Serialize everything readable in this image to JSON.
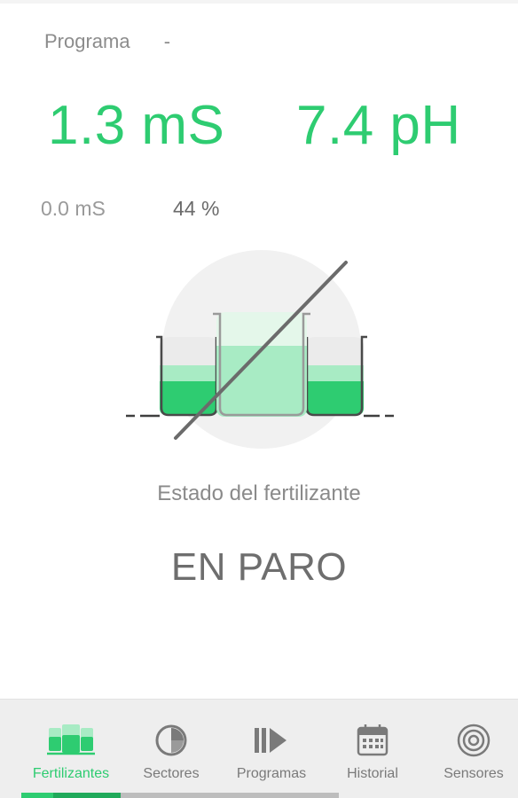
{
  "header": {
    "program_label": "Programa",
    "program_value": "-"
  },
  "readings": {
    "ec": "1.3 mS",
    "ph": "7.4 pH",
    "ec_target": "0.0 mS",
    "percent": "44 %"
  },
  "status": {
    "label": "Estado del fertilizante",
    "value": "EN PARO"
  },
  "nav": {
    "items": [
      {
        "label": "Fertilizantes",
        "icon": "beakers-icon",
        "active": true
      },
      {
        "label": "Sectores",
        "icon": "pie-chart-icon",
        "active": false
      },
      {
        "label": "Programas",
        "icon": "play-pause-icon",
        "active": false
      },
      {
        "label": "Historial",
        "icon": "calendar-icon",
        "active": false
      },
      {
        "label": "Sensores",
        "icon": "concentric-circles-icon",
        "active": false
      }
    ],
    "progress_fraction": 0.31
  },
  "colors": {
    "accent": "#2ecc71",
    "accent_dark": "#20a95a",
    "liquid_light": "#a8ebc4",
    "text_muted": "#8a8a8a",
    "nav_bg": "#eeeeee"
  }
}
